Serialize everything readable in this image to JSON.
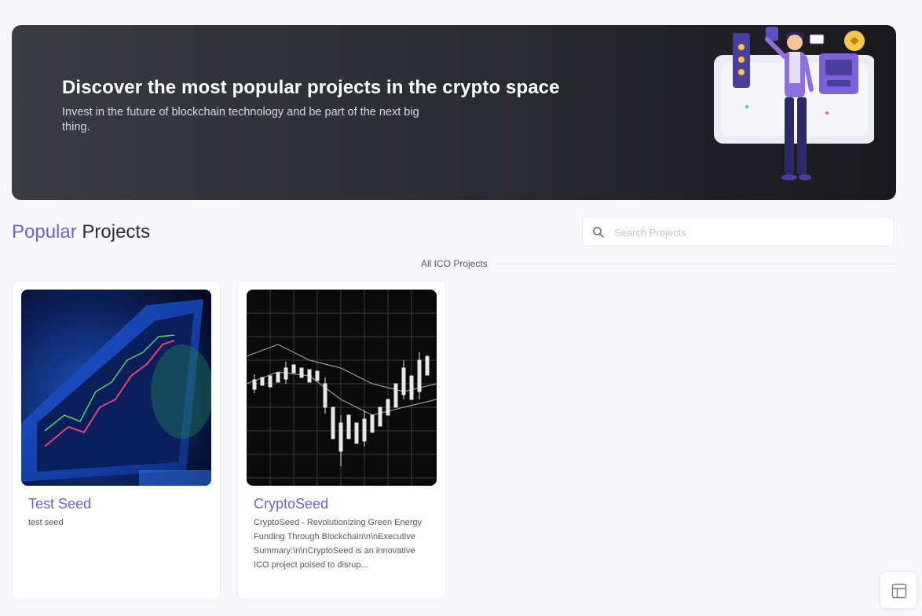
{
  "hero": {
    "title": "Discover the most popular projects in the crypto space",
    "subtitle": "Invest in the future of blockchain technology and be part of the next big thing."
  },
  "section": {
    "title_accent": "Popular",
    "title_rest": " Projects"
  },
  "search": {
    "placeholder": "Search Projects",
    "value": "",
    "icon": "search-icon"
  },
  "divider": {
    "label": "All ICO Projects"
  },
  "projects": [
    {
      "name": "Test Seed",
      "description": "test seed",
      "image": "trading-chart-screen"
    },
    {
      "name": "CryptoSeed",
      "description": "CryptoSeed - Revolutionizing Green Energy Funding Through Blockchain\\n\\nExecutive Summary:\\n\\nCryptoSeed is an innovative ICO project poised to disrup...",
      "image": "candlestick-chart"
    }
  ],
  "floating_button": {
    "icon": "layout-icon"
  },
  "colors": {
    "accent": "#6a63d6",
    "hero_dark": "#18181d",
    "page_bg": "#f8f8fa"
  }
}
